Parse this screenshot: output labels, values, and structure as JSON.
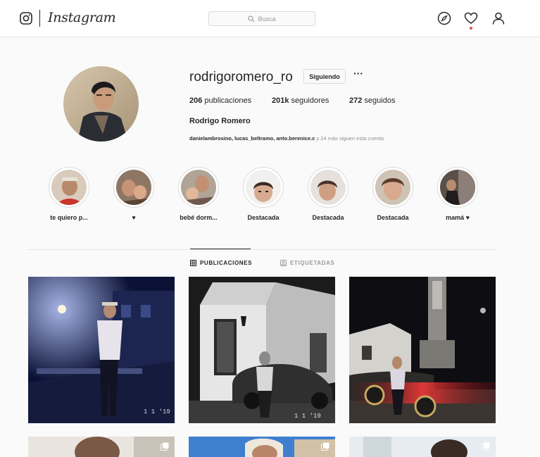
{
  "nav": {
    "app_title": "Instagram",
    "search_placeholder": "Busca"
  },
  "profile": {
    "username": "rodrigoromero_ro",
    "follow_label": "Siguiendo",
    "more_label": "···",
    "posts_count": "206",
    "posts_label": "publicaciones",
    "followers_count": "201k",
    "followers_label": "seguidores",
    "following_count": "272",
    "following_label": "seguidos",
    "full_name": "Rodrigo Romero",
    "followed_by_names": "danielambrosino, lucas_beltramo, anto.berenice.c",
    "followed_by_suffix": " y 24 más siguen esta cuenta"
  },
  "highlights": [
    {
      "label": "te quiero p..."
    },
    {
      "label": "♥"
    },
    {
      "label": "bebé dorm..."
    },
    {
      "label": "Destacada"
    },
    {
      "label": "Destacada"
    },
    {
      "label": "Destacada"
    },
    {
      "label": "mamá ♥"
    }
  ],
  "tabs": [
    {
      "label": "PUBLICACIONES",
      "active": true
    },
    {
      "label": "ETIQUETADAS",
      "active": false
    }
  ],
  "posts": [
    {
      "date_stamp": "1 1 '19"
    },
    {
      "date_stamp": "1 1 '19"
    },
    {
      "date_stamp": ""
    }
  ],
  "colors": {
    "text": "#262626",
    "muted": "#8e8e8e",
    "border": "#dbdbdb",
    "notification": "#ed4956"
  }
}
